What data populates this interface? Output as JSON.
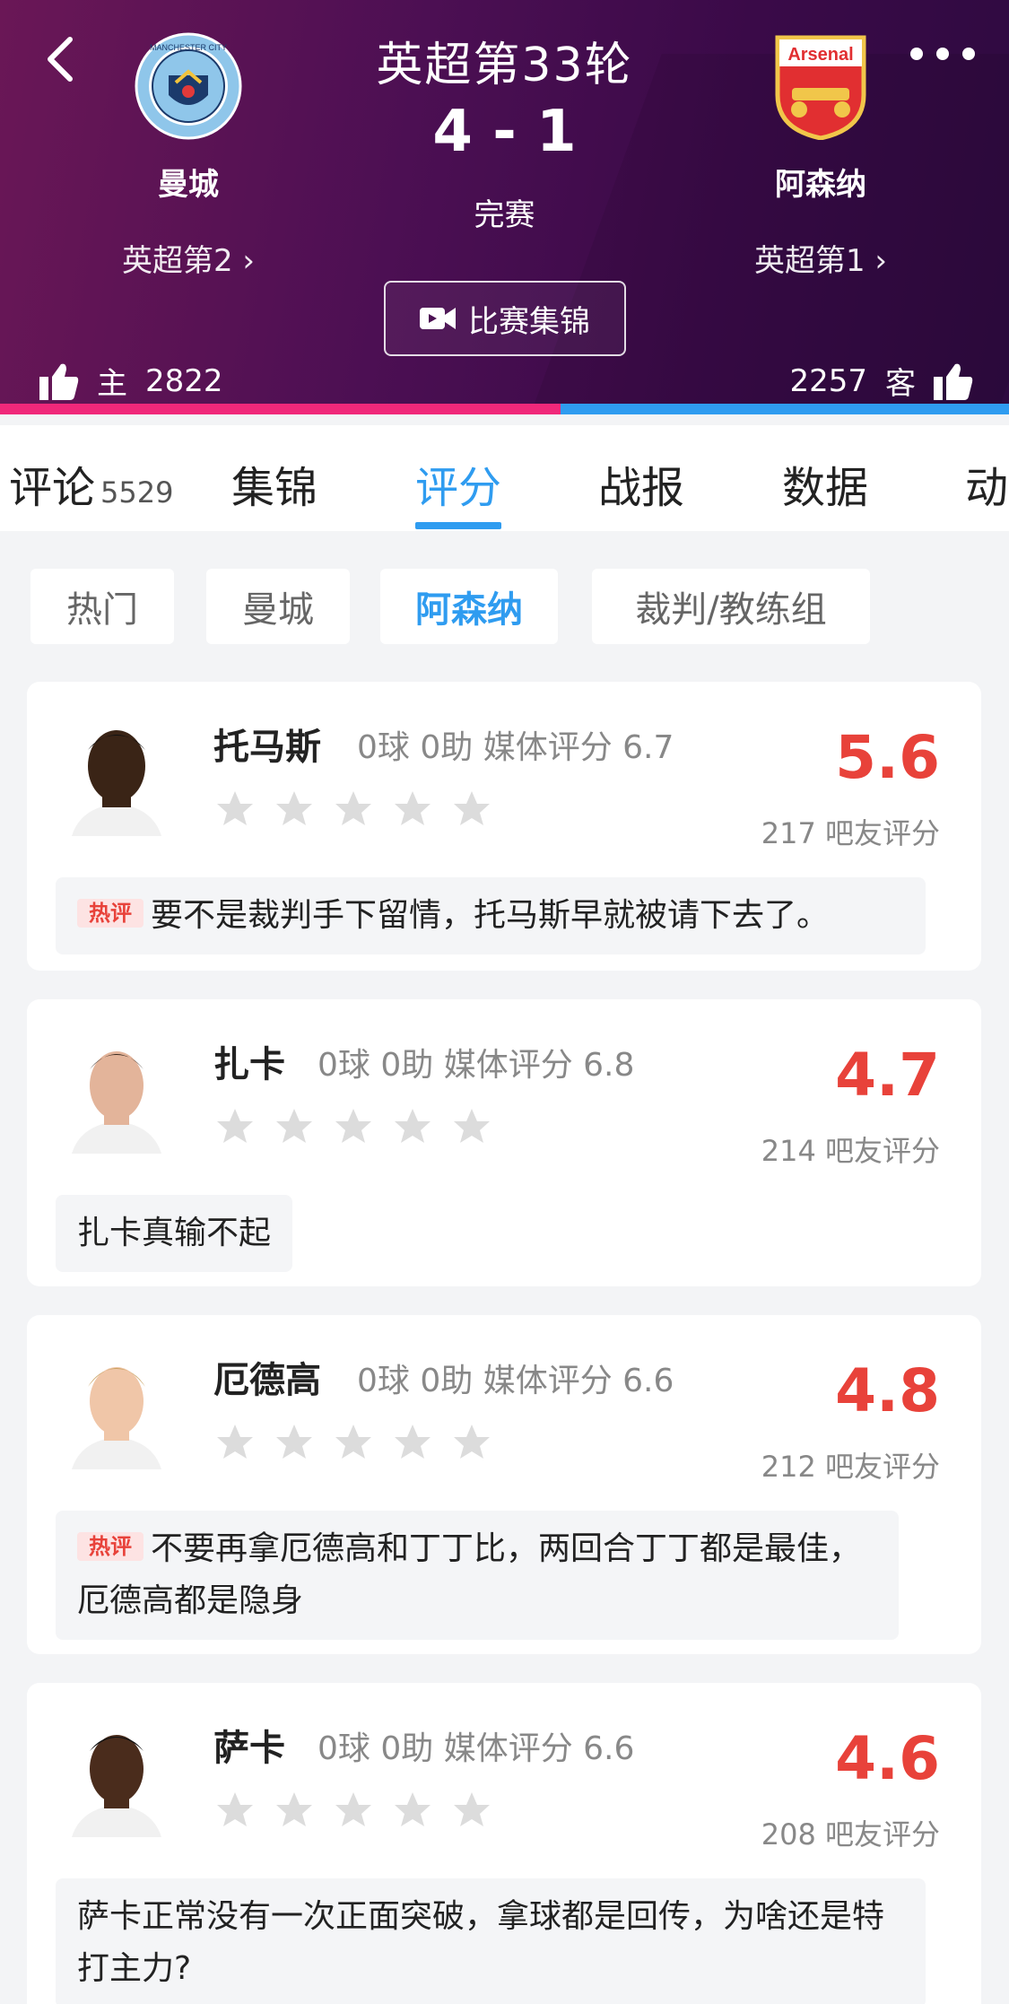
{
  "header": {
    "round": "英超第33轮",
    "score": "4 - 1",
    "status": "完赛",
    "home": {
      "name": "曼城",
      "rank": "英超第2",
      "likes_label": "主",
      "likes": "2822"
    },
    "away": {
      "name": "阿森纳",
      "rank": "英超第1",
      "likes_label": "客",
      "likes": "2257"
    },
    "highlights_label": "比赛集锦",
    "home_logo_text": "MANCHESTER CITY",
    "away_logo_text": "Arsenal"
  },
  "tabs": [
    {
      "label": "评论",
      "count": "5529"
    },
    {
      "label": "集锦"
    },
    {
      "label": "评分"
    },
    {
      "label": "战报"
    },
    {
      "label": "数据"
    },
    {
      "label": "动"
    }
  ],
  "filters": [
    "热门",
    "曼城",
    "阿森纳",
    "裁判/教练组"
  ],
  "hot_badge": "热评",
  "players": [
    {
      "name": "托马斯",
      "stats": "0球 0助  媒体评分 6.7",
      "rating": "5.6",
      "count": "217 吧友评分",
      "hot": true,
      "comment": "要不是裁判手下留情，托马斯早就被请下去了。"
    },
    {
      "name": "扎卡",
      "stats": "0球 0助  媒体评分 6.8",
      "rating": "4.7",
      "count": "214 吧友评分",
      "hot": false,
      "comment": "扎卡真输不起"
    },
    {
      "name": "厄德高",
      "stats": "0球 0助  媒体评分 6.6",
      "rating": "4.8",
      "count": "212 吧友评分",
      "hot": true,
      "comment": "不要再拿厄德高和丁丁比，两回合丁丁都是最佳，厄德高都是隐身"
    },
    {
      "name": "萨卡",
      "stats": "0球 0助  媒体评分 6.6",
      "rating": "4.6",
      "count": "208 吧友评分",
      "hot": false,
      "comment": "萨卡正常没有一次正面突破，拿球都是回传，为啥还是特打主力?"
    }
  ],
  "colors": {
    "accent": "#2f9cf0",
    "rating": "#e8423a",
    "home": "#f0287a",
    "away": "#2f9cf0"
  }
}
